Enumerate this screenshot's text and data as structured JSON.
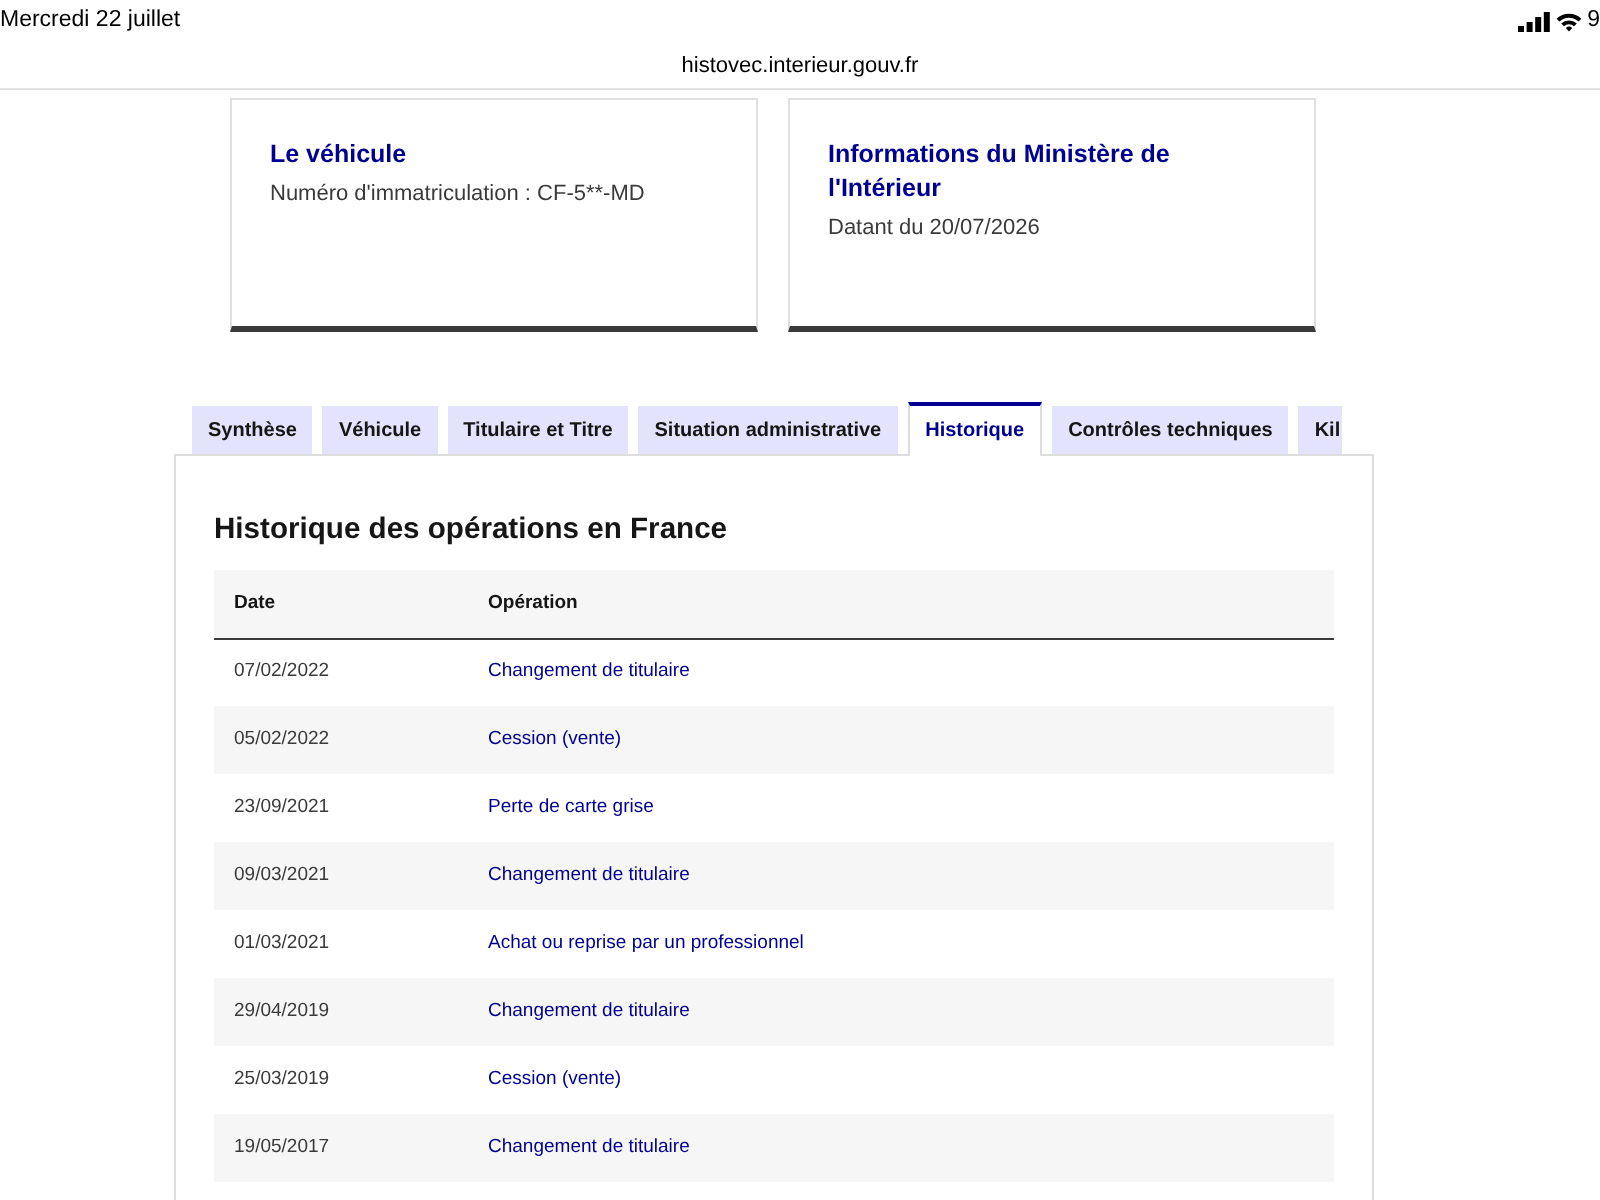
{
  "status_bar": {
    "date": "Mercredi 22 juillet",
    "battery": "9"
  },
  "address_bar": {
    "url": "histovec.interieur.gouv.fr"
  },
  "cards": [
    {
      "title": "Le véhicule",
      "text": "Numéro d'immatriculation : CF-5**-MD"
    },
    {
      "title": "Informations du Ministère de l'Intérieur",
      "text": "Datant du 20/07/2026"
    }
  ],
  "tabs": [
    {
      "label": "Synthèse",
      "selected": false
    },
    {
      "label": "Véhicule",
      "selected": false
    },
    {
      "label": "Titulaire et Titre",
      "selected": false
    },
    {
      "label": "Situation administrative",
      "selected": false
    },
    {
      "label": "Historique",
      "selected": true
    },
    {
      "label": "Contrôles techniques",
      "selected": false
    },
    {
      "label": "Kil",
      "selected": false
    }
  ],
  "panel": {
    "heading": "Historique des opérations en France",
    "table": {
      "columns": [
        "Date",
        "Opération"
      ],
      "rows": [
        {
          "date": "07/02/2022",
          "operation": "Changement de titulaire"
        },
        {
          "date": "05/02/2022",
          "operation": "Cession (vente)"
        },
        {
          "date": "23/09/2021",
          "operation": "Perte de carte grise"
        },
        {
          "date": "09/03/2021",
          "operation": "Changement de titulaire"
        },
        {
          "date": "01/03/2021",
          "operation": "Achat ou reprise par un professionnel"
        },
        {
          "date": "29/04/2019",
          "operation": "Changement de titulaire"
        },
        {
          "date": "25/03/2019",
          "operation": "Cession (vente)"
        },
        {
          "date": "19/05/2017",
          "operation": "Changement de titulaire"
        }
      ]
    }
  }
}
